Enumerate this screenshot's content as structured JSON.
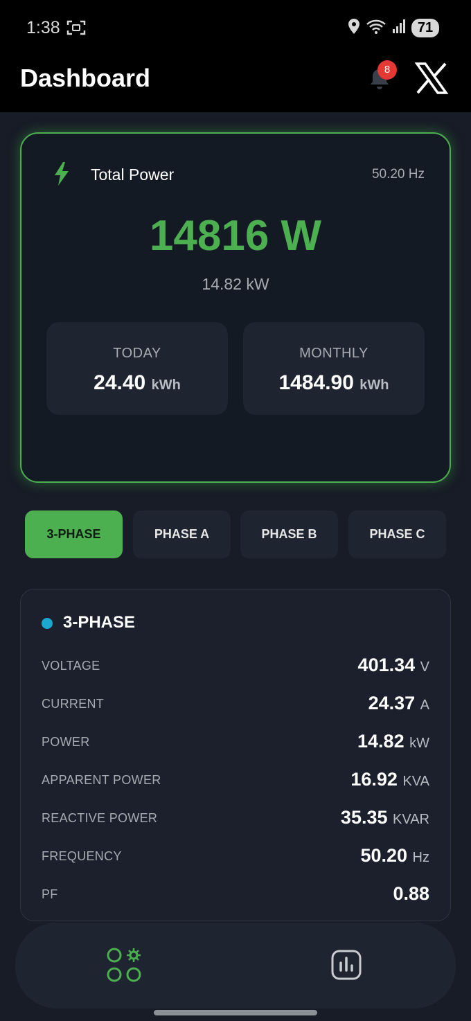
{
  "status_bar": {
    "time": "1:38",
    "battery": "71",
    "icons": [
      "screenshot-icon",
      "location-icon",
      "wifi-icon",
      "signal-icon"
    ]
  },
  "header": {
    "title": "Dashboard",
    "notification_count": "8"
  },
  "power_card": {
    "title": "Total Power",
    "frequency": "50.20 Hz",
    "watts": "14816 W",
    "kilowatts": "14.82 kW",
    "today": {
      "label": "TODAY",
      "value": "24.40",
      "unit": "kWh"
    },
    "monthly": {
      "label": "MONTHLY",
      "value": "1484.90",
      "unit": "kWh"
    }
  },
  "tabs": [
    {
      "label": "3-PHASE",
      "active": true
    },
    {
      "label": "PHASE A",
      "active": false
    },
    {
      "label": "PHASE B",
      "active": false
    },
    {
      "label": "PHASE C",
      "active": false
    }
  ],
  "details": {
    "title": "3-PHASE",
    "metrics": [
      {
        "label": "VOLTAGE",
        "value": "401.34",
        "unit": "V"
      },
      {
        "label": "CURRENT",
        "value": "24.37",
        "unit": "A"
      },
      {
        "label": "POWER",
        "value": "14.82",
        "unit": "kW"
      },
      {
        "label": "APPARENT POWER",
        "value": "16.92",
        "unit": "KVA"
      },
      {
        "label": "REACTIVE POWER",
        "value": "35.35",
        "unit": "KVAR"
      },
      {
        "label": "FREQUENCY",
        "value": "50.20",
        "unit": "Hz"
      },
      {
        "label": "PF",
        "value": "0.88",
        "unit": ""
      }
    ]
  },
  "colors": {
    "accent": "#4caf50",
    "background": "#171c26",
    "card": "#1e2430",
    "phase_dot": "#1ba7cf",
    "badge": "#e53935"
  }
}
